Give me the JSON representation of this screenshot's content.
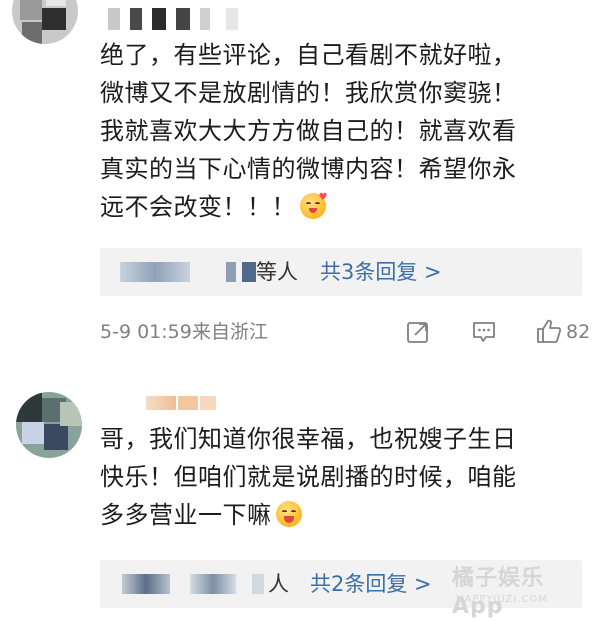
{
  "comments": [
    {
      "body_lines": [
        "绝了，有些评论，自己看剧不就好啦，",
        "微博又不是放剧情的！我欣赏你窦骁！",
        "我就喜欢大大方方做自己的！就喜欢看",
        "真实的当下心情的微博内容！希望你永",
        "远不会改变！！！"
      ],
      "emoji": "heart-kiss-emoji",
      "replies": {
        "others": "等人",
        "count": "共3条回复 >"
      },
      "meta": {
        "time": "5-9 01:59",
        "location": "来自浙江",
        "likes": "82"
      }
    },
    {
      "body_lines": [
        "哥，我们知道你很幸福，也祝嫂子生日",
        "快乐！但咱们就是说剧播的时候，咱能",
        "多多营业一下嘛"
      ],
      "emoji": "tongue-emoji",
      "replies": {
        "others": "人",
        "count": "共2条回复 >"
      }
    }
  ],
  "icons": {
    "share": "share-icon",
    "comment": "comment-icon",
    "like": "thumbs-up-icon"
  },
  "watermark": {
    "main": "橘子娱乐App",
    "sub": "HAPPYJUZI.COM"
  },
  "colors": {
    "link": "#3c6eaa",
    "meta": "#808080",
    "reply_bg": "#f2f2f2"
  }
}
